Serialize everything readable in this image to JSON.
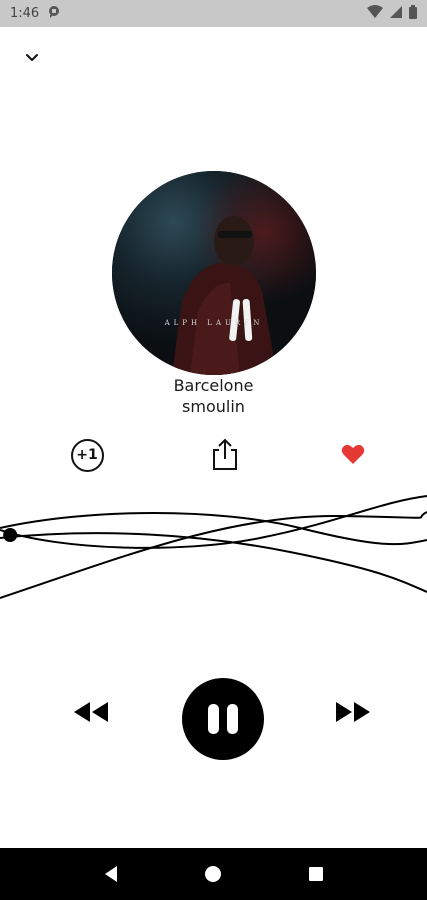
{
  "status_bar": {
    "time": "1:46",
    "icons": [
      "notification-icon",
      "wifi-icon",
      "signal-icon",
      "battery-icon"
    ]
  },
  "header": {
    "collapse_icon": "chevron-down-icon"
  },
  "album": {
    "artwork": "album-cover",
    "cover_text": "ALPH LAUREN"
  },
  "track": {
    "title": "Barcelone",
    "artist": "smoulin"
  },
  "actions": {
    "plus_one_label": "+1",
    "share_icon": "share-icon",
    "like_icon": "heart-icon",
    "like_color": "#e53935",
    "liked": true
  },
  "playback": {
    "state": "playing",
    "progress": 0.01,
    "prev_icon": "rewind-icon",
    "play_pause_icon": "pause-icon",
    "next_icon": "fast-forward-icon"
  },
  "nav_bar": {
    "icons": [
      "back-icon",
      "home-icon",
      "recents-icon"
    ]
  },
  "colors": {
    "background": "#ffffff",
    "status_bar": "#c8c8c8",
    "accent": "#000000"
  }
}
